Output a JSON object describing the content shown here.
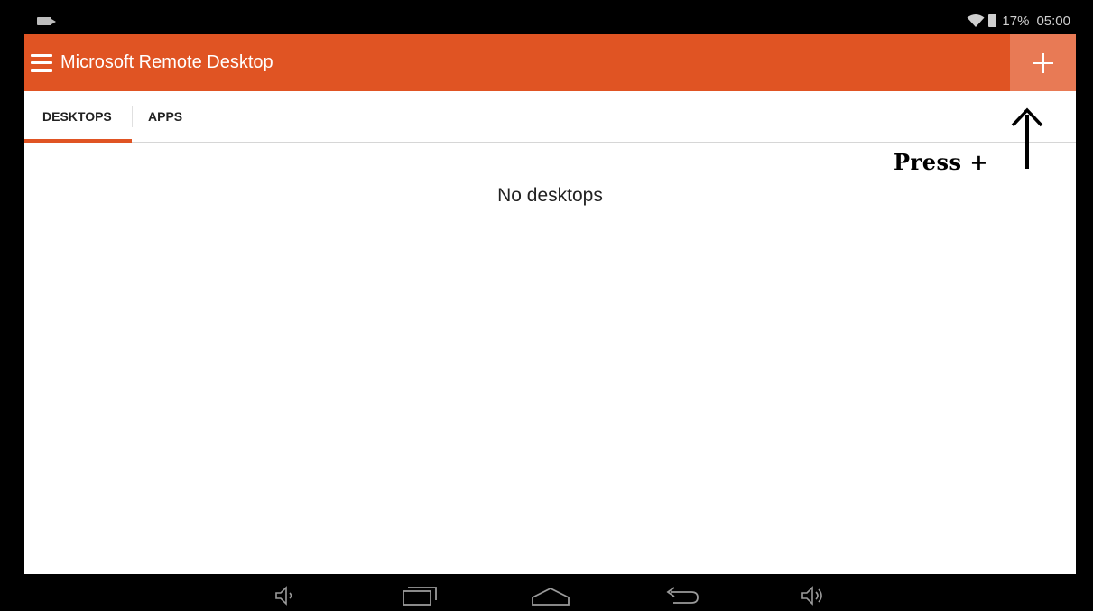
{
  "status_bar": {
    "battery": "17%",
    "time": "05:00",
    "icons": [
      "notification-icon",
      "wifi-icon",
      "battery-icon"
    ]
  },
  "app_bar": {
    "title": "Microsoft Remote Desktop",
    "menu_icon": "hamburger-menu-icon",
    "add_icon": "plus-icon",
    "color": "#e05423",
    "add_button_color": "#e87a55"
  },
  "tabs": [
    {
      "label": "DESKTOPS",
      "active": true
    },
    {
      "label": "APPS",
      "active": false
    }
  ],
  "main": {
    "empty_message": "No desktops"
  },
  "annotation": {
    "text": "Press +"
  },
  "nav_bar": {
    "buttons": [
      "volume-down-icon",
      "recent-apps-icon",
      "home-icon",
      "back-icon",
      "volume-up-icon"
    ]
  }
}
